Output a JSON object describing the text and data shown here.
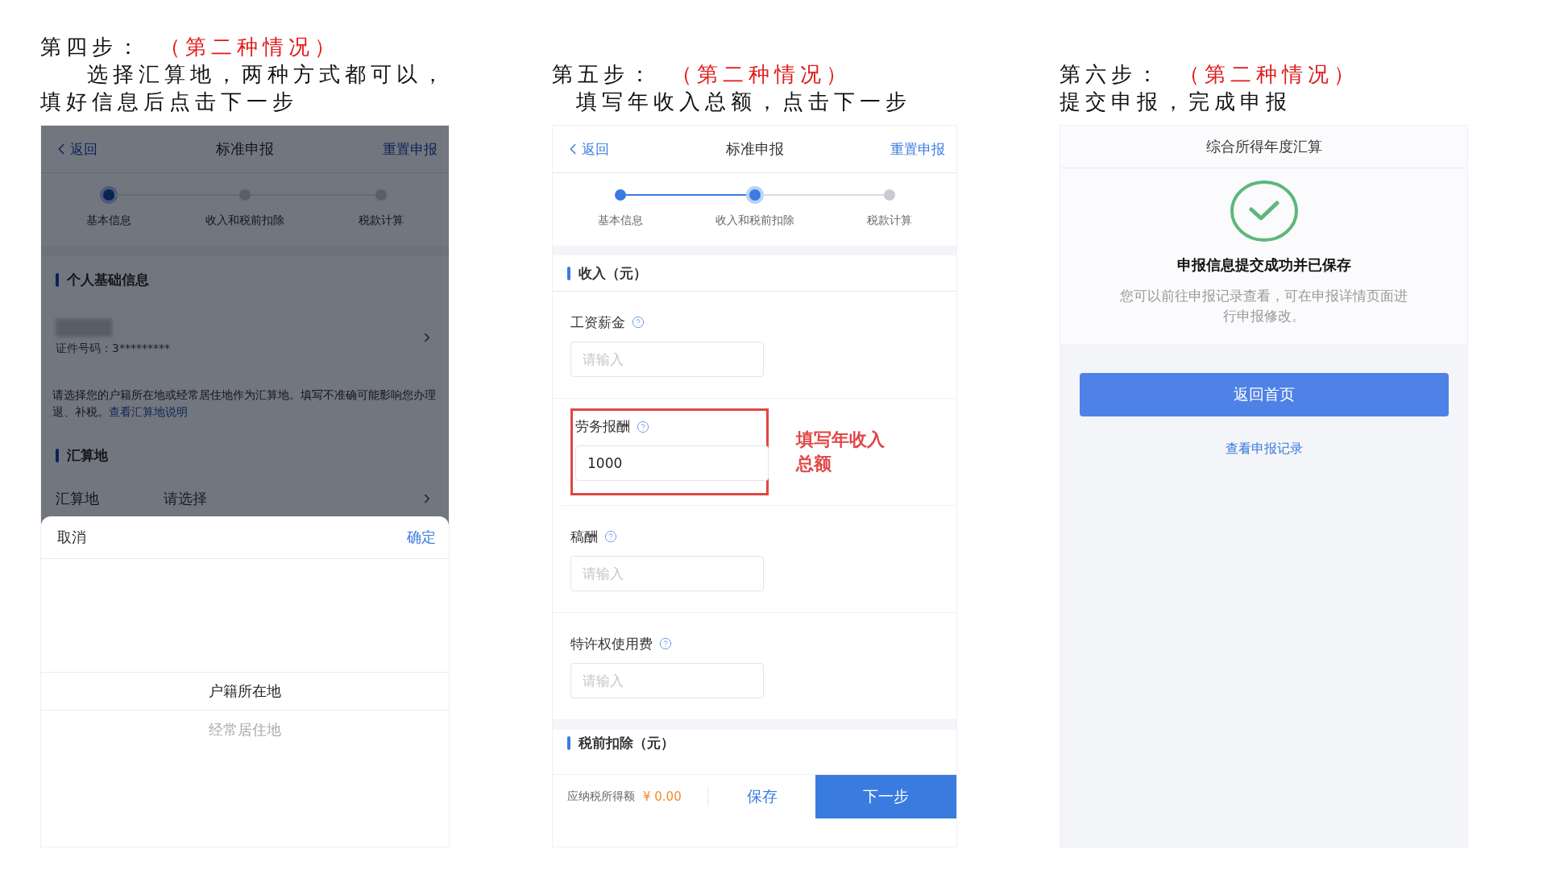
{
  "screens": [
    {
      "kind": "location",
      "caption": {
        "step": "第四步：",
        "case": "（第二种情况）",
        "lines": [
          "选择汇算地，两种方式都可以，",
          "填好信息后点击下一步"
        ]
      },
      "dimmed": true,
      "nav": {
        "back": "返回",
        "title": "标准申报",
        "action": "重置申报"
      },
      "progress": [
        {
          "label": "基本信息",
          "done": false,
          "selected": true
        },
        {
          "label": "收入和税前扣除",
          "done": false,
          "selected": false
        },
        {
          "label": "税款计算",
          "done": false,
          "selected": false
        }
      ],
      "personal_section": "个人基础信息",
      "id_number": "证件号码：3*********",
      "notice": "请选择您的户籍所在地或经常居住地作为汇算地。填写不准确可能影响您办理退、补税。",
      "notice_link": "查看汇算地说明",
      "location_section": "汇算地",
      "location_row": {
        "label": "汇算地",
        "placeholder": "请选择"
      },
      "picker": {
        "cancel": "取消",
        "confirm": "确定",
        "options": [
          {
            "label": "户籍所在地",
            "selected": true
          },
          {
            "label": "经常居住地",
            "selected": false
          }
        ]
      }
    },
    {
      "kind": "income",
      "caption": {
        "step": "第五步：",
        "case": "（第二种情况）",
        "lines": [
          "填写年收入总额，点击下一步"
        ]
      },
      "dimmed": false,
      "nav": {
        "back": "返回",
        "title": "标准申报",
        "action": "重置申报"
      },
      "progress": [
        {
          "label": "基本信息",
          "done": true,
          "selected": false
        },
        {
          "label": "收入和税前扣除",
          "done": false,
          "selected": true
        },
        {
          "label": "税款计算",
          "done": false,
          "selected": false
        }
      ],
      "income_section": "收入（元）",
      "fields": [
        {
          "label": "工资薪金",
          "placeholder": "请输入",
          "highlighted": false
        },
        {
          "label": "劳务报酬",
          "value": "1000",
          "highlighted": true,
          "annotation": "填写年收入总额"
        },
        {
          "label": "稿酬",
          "placeholder": "请输入",
          "highlighted": false
        },
        {
          "label": "特许权使用费",
          "placeholder": "请输入",
          "highlighted": false
        }
      ],
      "deduction_section": "税前扣除（元）",
      "footer": {
        "taxable_label": "应纳税所得额",
        "taxable_amount": "¥ 0.00",
        "save": "保存",
        "next": "下一步"
      }
    },
    {
      "kind": "done",
      "caption": {
        "step": "第六步：",
        "case": "（第二种情况）",
        "lines": [
          "提交申报，完成申报"
        ]
      },
      "title": "综合所得年度汇算",
      "message": "申报信息提交成功并已保存",
      "detail": "您可以前往申报记录查看，可在申报详情页面进行申报修改。",
      "home_button": "返回首页",
      "records_link": "查看申报记录"
    }
  ]
}
